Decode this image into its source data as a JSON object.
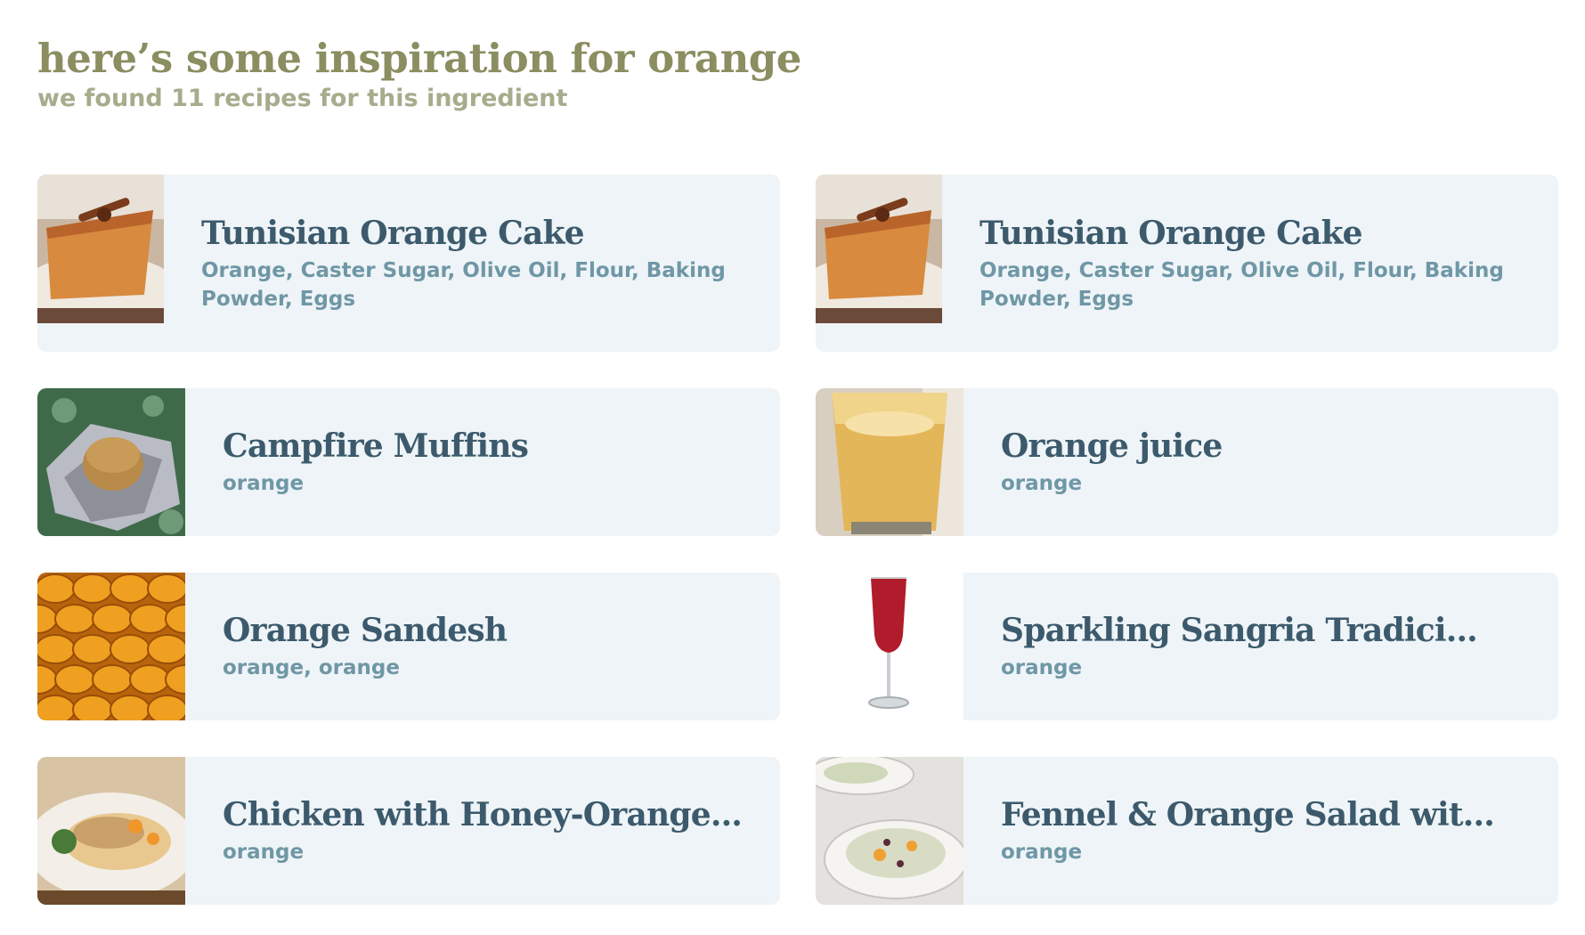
{
  "header": {
    "title": "here’s some inspiration for orange",
    "subtitle": "we found 11 recipes for this ingredient"
  },
  "recipes": [
    {
      "title": "Tunisian Orange Cake",
      "ingredients": "Orange, Caster Sugar, Olive Oil, Flour, Baking Powder, Eggs",
      "image": "orange-cake-photo"
    },
    {
      "title": "Tunisian Orange Cake",
      "ingredients": "Orange, Caster Sugar, Olive Oil, Flour, Baking Powder, Eggs",
      "image": "orange-cake-photo"
    },
    {
      "title": "Campfire Muffins",
      "ingredients": "orange",
      "image": "muffin-in-foil-photo"
    },
    {
      "title": "Orange juice",
      "ingredients": "orange",
      "image": "orange-juice-glass-photo"
    },
    {
      "title": "Orange Sandesh",
      "ingredients": "orange, orange",
      "image": "orange-sandesh-photo"
    },
    {
      "title": "Sparkling Sangria Tradici...",
      "ingredients": "orange",
      "image": "sangria-flute-photo"
    },
    {
      "title": "Chicken with Honey-Orange...",
      "ingredients": "orange",
      "image": "chicken-plate-photo"
    },
    {
      "title": "Fennel & Orange Salad wit...",
      "ingredients": "orange",
      "image": "fennel-salad-photo"
    }
  ]
}
